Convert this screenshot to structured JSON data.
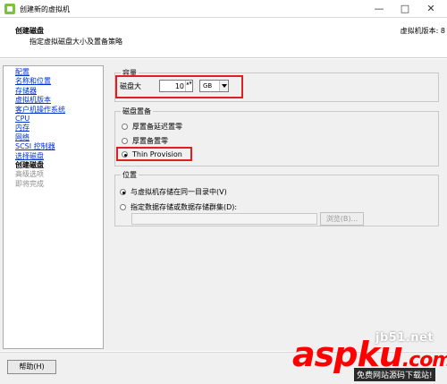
{
  "window": {
    "title": "创建新的虚拟机",
    "controls": {
      "minimize": "—",
      "maximize": "□",
      "close": "✕"
    },
    "icon": "vm-app-icon"
  },
  "header": {
    "title": "创建磁盘",
    "subtitle": "指定虚拟磁盘大小及置备策略",
    "version": "虚拟机版本: 8"
  },
  "sidebar": {
    "items": [
      {
        "label": "配置",
        "state": "link"
      },
      {
        "label": "名称和位置",
        "state": "link"
      },
      {
        "label": "存储器",
        "state": "link"
      },
      {
        "label": "虚拟机版本",
        "state": "link"
      },
      {
        "label": "客户机操作系统",
        "state": "link"
      },
      {
        "label": "CPU",
        "state": "link"
      },
      {
        "label": "内存",
        "state": "link"
      },
      {
        "label": "网络",
        "state": "link"
      },
      {
        "label": "SCSI 控制器",
        "state": "link"
      },
      {
        "label": "选择磁盘",
        "state": "link"
      },
      {
        "label": "创建磁盘",
        "state": "current"
      },
      {
        "label": "高级选项",
        "state": "disabled"
      },
      {
        "label": "即将完成",
        "state": "disabled"
      }
    ]
  },
  "capacity": {
    "legend": "容量",
    "label": "磁盘大",
    "value": "10",
    "spin_arrows": "▲▼",
    "unit": "GB"
  },
  "provisioning": {
    "legend": "磁盘置备",
    "options": [
      {
        "label": "厚置备延迟置零",
        "checked": false
      },
      {
        "label": "厚置备置零",
        "checked": false
      },
      {
        "label": "Thin Provision",
        "checked": true
      }
    ]
  },
  "location": {
    "legend": "位置",
    "options": [
      {
        "label": "与虚拟机存储在同一目录中(V)",
        "checked": true
      },
      {
        "label": "指定数据存储或数据存储群集(D):",
        "checked": false
      }
    ],
    "path_value": "",
    "browse_label": "浏览(B)..."
  },
  "footer": {
    "help_label": "帮助(H)"
  },
  "watermark": {
    "domain": "jb51.net",
    "logo": "aspku",
    "logo_suffix": ".com",
    "tagline": "免费网站源码下载站!"
  },
  "colors": {
    "highlight": "#e02020",
    "link": "#0033cc",
    "disabled": "#8a8a8a",
    "watermark_red": "#ff0000"
  }
}
